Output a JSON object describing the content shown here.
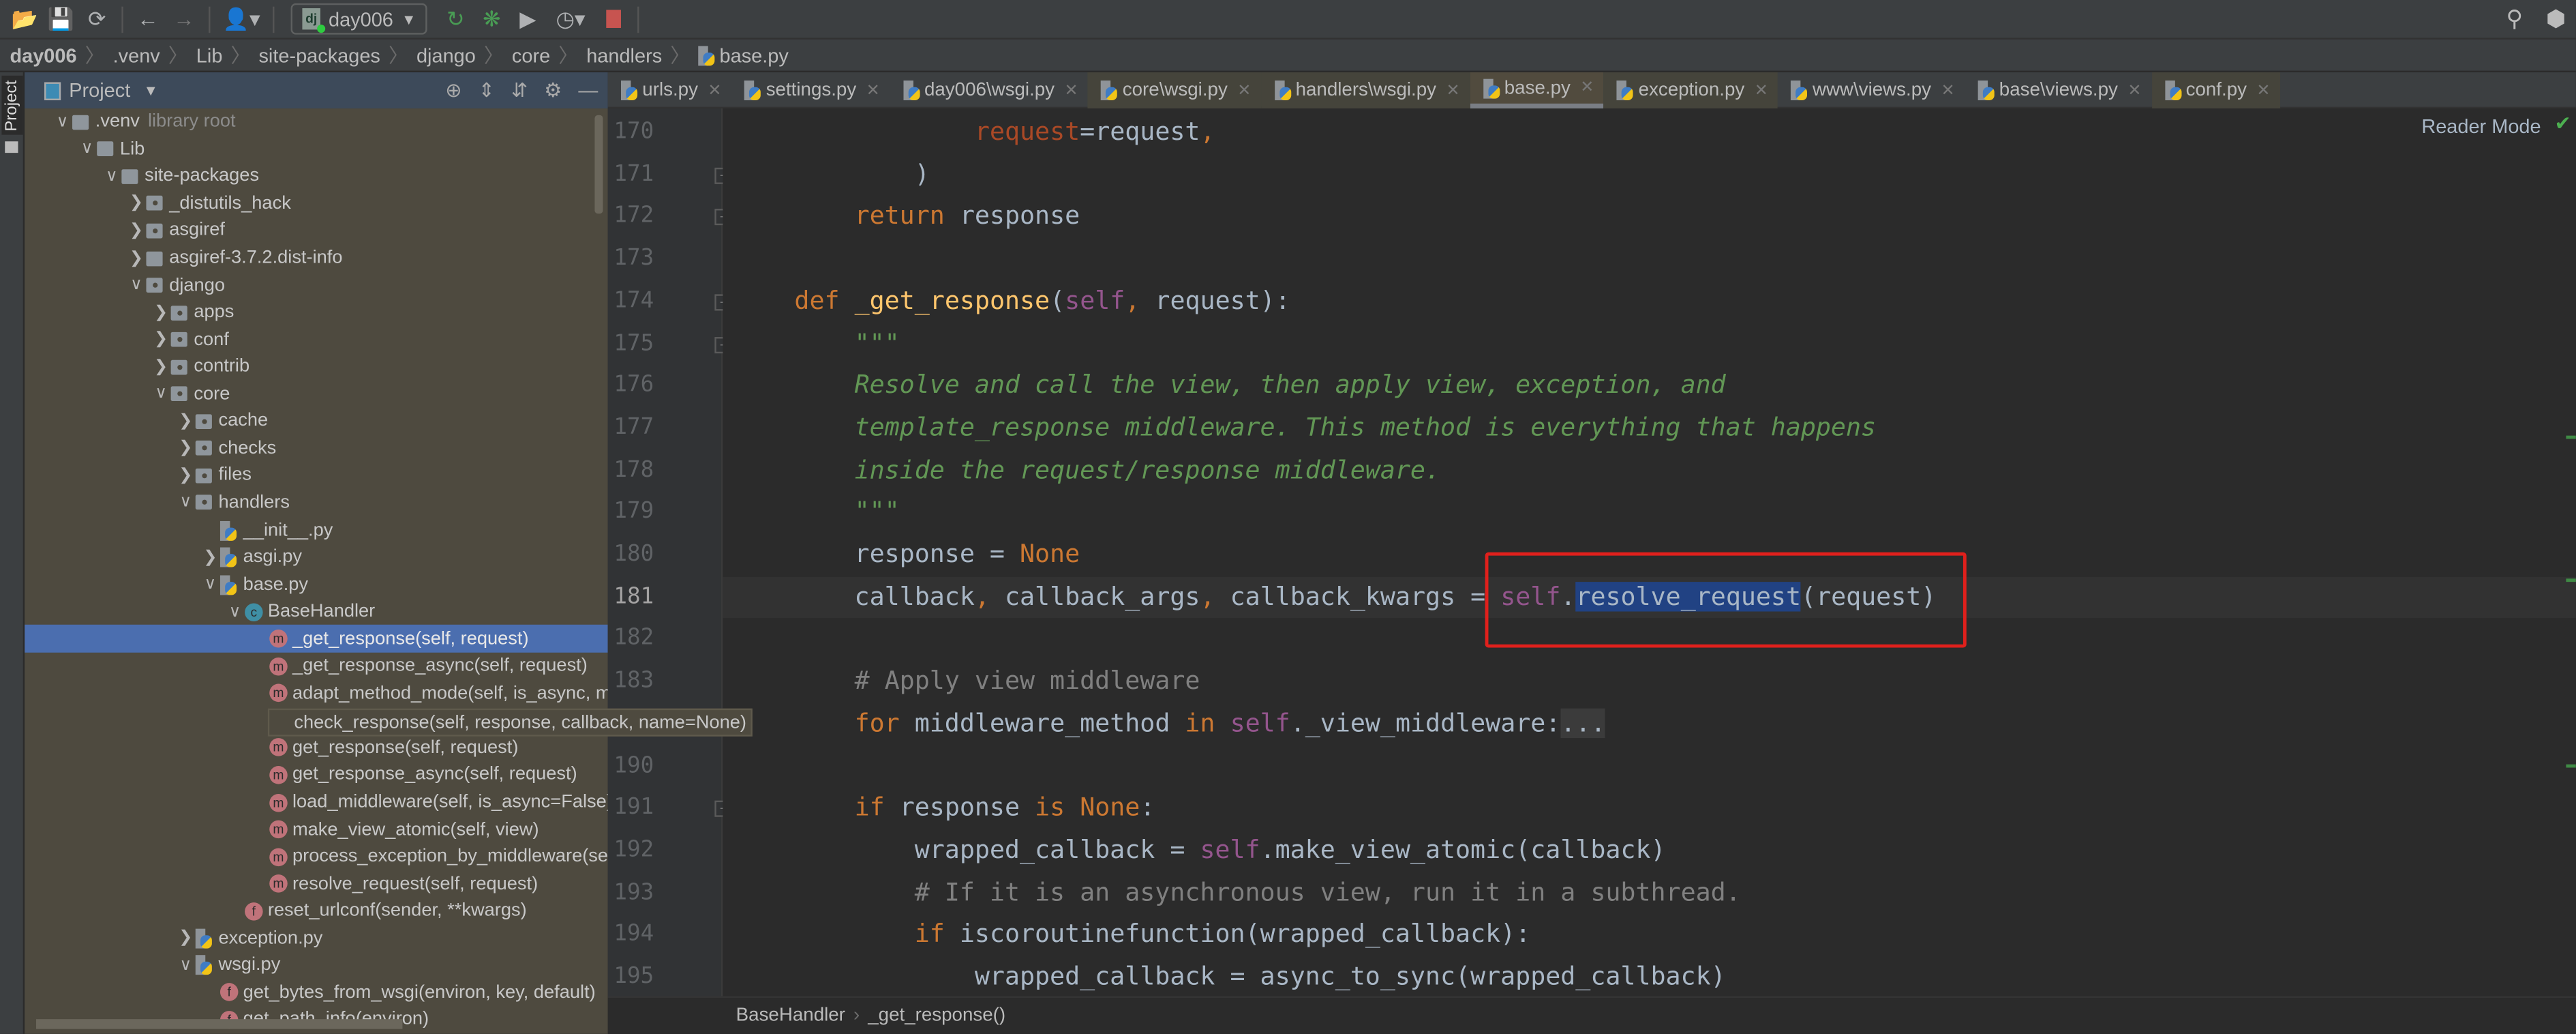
{
  "toolbar": {
    "icons": [
      "folder-open-icon",
      "save-icon",
      "sync-icon",
      "back-icon",
      "forward-icon",
      "user-icon"
    ],
    "run_config": "day006",
    "run_icons": [
      "rerun-icon",
      "debug-icon",
      "coverage-icon",
      "profile-icon",
      "stop-icon"
    ],
    "colors": {
      "run": "#499c54",
      "stop": "#c75450"
    }
  },
  "breadcrumb": [
    "day006",
    ".venv",
    "Lib",
    "site-packages",
    "django",
    "core",
    "handlers",
    "base.py"
  ],
  "side_stripe": {
    "label": "Project"
  },
  "project_panel": {
    "title": "Project"
  },
  "tree": [
    {
      "depth": 0,
      "arrow": "down",
      "icon": "folder",
      "label": ".venv",
      "suffix": "library root"
    },
    {
      "depth": 1,
      "arrow": "down",
      "icon": "folder",
      "label": "Lib"
    },
    {
      "depth": 2,
      "arrow": "down",
      "icon": "folder",
      "label": "site-packages"
    },
    {
      "depth": 3,
      "arrow": "right",
      "icon": "pkg",
      "label": "_distutils_hack"
    },
    {
      "depth": 3,
      "arrow": "right",
      "icon": "pkg",
      "label": "asgiref"
    },
    {
      "depth": 3,
      "arrow": "right",
      "icon": "folder",
      "label": "asgiref-3.7.2.dist-info"
    },
    {
      "depth": 3,
      "arrow": "down",
      "icon": "pkg",
      "label": "django"
    },
    {
      "depth": 4,
      "arrow": "right",
      "icon": "pkg",
      "label": "apps"
    },
    {
      "depth": 4,
      "arrow": "right",
      "icon": "pkg",
      "label": "conf"
    },
    {
      "depth": 4,
      "arrow": "right",
      "icon": "pkg",
      "label": "contrib"
    },
    {
      "depth": 4,
      "arrow": "down",
      "icon": "pkg",
      "label": "core"
    },
    {
      "depth": 5,
      "arrow": "right",
      "icon": "pkg",
      "label": "cache"
    },
    {
      "depth": 5,
      "arrow": "right",
      "icon": "pkg",
      "label": "checks"
    },
    {
      "depth": 5,
      "arrow": "right",
      "icon": "pkg",
      "label": "files"
    },
    {
      "depth": 5,
      "arrow": "down",
      "icon": "pkg",
      "label": "handlers"
    },
    {
      "depth": 6,
      "arrow": "none",
      "icon": "py",
      "label": "__init__.py"
    },
    {
      "depth": 6,
      "arrow": "right",
      "icon": "py",
      "label": "asgi.py"
    },
    {
      "depth": 6,
      "arrow": "down",
      "icon": "py",
      "label": "base.py"
    },
    {
      "depth": 7,
      "arrow": "down",
      "icon": "c",
      "label": "BaseHandler"
    },
    {
      "depth": 8,
      "arrow": "none",
      "icon": "m",
      "label": "_get_response(self, request)",
      "selected": true
    },
    {
      "depth": 8,
      "arrow": "none",
      "icon": "m",
      "label": "_get_response_async(self, request)"
    },
    {
      "depth": 8,
      "arrow": "none",
      "icon": "m",
      "label": "adapt_method_mode(self, is_async, meth"
    },
    {
      "depth": 8,
      "arrow": "none",
      "icon": "m",
      "label": "check_response(self, response, callback, name=None)"
    },
    {
      "depth": 8,
      "arrow": "none",
      "icon": "m",
      "label": "get_response(self, request)"
    },
    {
      "depth": 8,
      "arrow": "none",
      "icon": "m",
      "label": "get_response_async(self, request)"
    },
    {
      "depth": 8,
      "arrow": "none",
      "icon": "m",
      "label": "load_middleware(self, is_async=False)"
    },
    {
      "depth": 8,
      "arrow": "none",
      "icon": "m",
      "label": "make_view_atomic(self, view)"
    },
    {
      "depth": 8,
      "arrow": "none",
      "icon": "m",
      "label": "process_exception_by_middleware(self, e"
    },
    {
      "depth": 8,
      "arrow": "none",
      "icon": "m",
      "label": "resolve_request(self, request)"
    },
    {
      "depth": 7,
      "arrow": "none",
      "icon": "f",
      "label": "reset_urlconf(sender, **kwargs)"
    },
    {
      "depth": 5,
      "arrow": "right",
      "icon": "py",
      "label": "exception.py"
    },
    {
      "depth": 5,
      "arrow": "down",
      "icon": "py",
      "label": "wsgi.py"
    },
    {
      "depth": 6,
      "arrow": "none",
      "icon": "f",
      "label": "get_bytes_from_wsgi(environ, key, default)"
    },
    {
      "depth": 6,
      "arrow": "none",
      "icon": "f",
      "label": "get_path_info(environ)"
    }
  ],
  "tabs": [
    {
      "label": "urls.py",
      "style": "plain"
    },
    {
      "label": "settings.py",
      "style": "plain"
    },
    {
      "label": "day006\\wsgi.py",
      "style": "plain"
    },
    {
      "label": "core\\wsgi.py",
      "style": "olive"
    },
    {
      "label": "handlers\\wsgi.py",
      "style": "olive"
    },
    {
      "label": "base.py",
      "style": "active"
    },
    {
      "label": "exception.py",
      "style": "olive"
    },
    {
      "label": "www\\views.py",
      "style": "plain"
    },
    {
      "label": "base\\views.py",
      "style": "plain"
    },
    {
      "label": "conf.py",
      "style": "olive"
    }
  ],
  "editor": {
    "reader_mode": "Reader Mode",
    "current_line": "181",
    "lines": [
      {
        "n": "170",
        "t": [
          [
            "                "
          ],
          [
            "request",
            "param"
          ],
          [
            "=request"
          ],
          [
            ",",
            "kw"
          ]
        ]
      },
      {
        "n": "171",
        "t": [
          [
            "            )"
          ]
        ],
        "fold": true
      },
      {
        "n": "172",
        "t": [
          [
            "        "
          ],
          [
            "return",
            "kw"
          ],
          [
            " response"
          ]
        ],
        "fold": true
      },
      {
        "n": "173",
        "t": []
      },
      {
        "n": "174",
        "t": [
          [
            "    "
          ],
          [
            "def",
            "kw"
          ],
          [
            " "
          ],
          [
            "_get_response",
            "fn"
          ],
          [
            "("
          ],
          [
            "self",
            "self"
          ],
          [
            ",",
            "kw"
          ],
          [
            " request):"
          ]
        ],
        "fold": true
      },
      {
        "n": "175",
        "t": [
          [
            "        "
          ],
          [
            "\"\"\"",
            "doc"
          ]
        ],
        "fold": true
      },
      {
        "n": "176",
        "t": [
          [
            "        "
          ],
          [
            "Resolve and call the view, then apply view, exception, and",
            "doc"
          ]
        ]
      },
      {
        "n": "177",
        "t": [
          [
            "        "
          ],
          [
            "template_response middleware. This method is everything that happens",
            "doc"
          ]
        ]
      },
      {
        "n": "178",
        "t": [
          [
            "        "
          ],
          [
            "inside the request/response middleware.",
            "doc"
          ]
        ]
      },
      {
        "n": "179",
        "t": [
          [
            "        "
          ],
          [
            "\"\"\"",
            "doc"
          ]
        ]
      },
      {
        "n": "180",
        "t": [
          [
            "        response = "
          ],
          [
            "None",
            "kw"
          ]
        ]
      },
      {
        "n": "181",
        "t": [
          [
            "        callback"
          ],
          [
            ",",
            "kw"
          ],
          [
            " callback_args"
          ],
          [
            ",",
            "kw"
          ],
          [
            " callback_kwargs = "
          ],
          [
            "self",
            "self"
          ],
          [
            "."
          ],
          [
            "resolve_request",
            "hl"
          ],
          [
            "(request)"
          ]
        ]
      },
      {
        "n": "182",
        "t": []
      },
      {
        "n": "183",
        "t": [
          [
            "        "
          ],
          [
            "# Apply view middleware",
            "cmt"
          ]
        ]
      },
      {
        "n": "184",
        "t": [
          [
            "        "
          ],
          [
            "for",
            "kw"
          ],
          [
            " middleware_method "
          ],
          [
            "in",
            "kw"
          ],
          [
            " "
          ],
          [
            "self",
            "self"
          ],
          [
            "._view_middleware:"
          ],
          [
            "...",
            "fld"
          ]
        ],
        "fold": true
      },
      {
        "n": "190",
        "t": []
      },
      {
        "n": "191",
        "t": [
          [
            "        "
          ],
          [
            "if",
            "kw"
          ],
          [
            " response "
          ],
          [
            "is",
            "kw"
          ],
          [
            " "
          ],
          [
            "None",
            "kw"
          ],
          [
            ":"
          ]
        ],
        "fold": true
      },
      {
        "n": "192",
        "t": [
          [
            "            wrapped_callback = "
          ],
          [
            "self",
            "self"
          ],
          [
            ".make_view_atomic(callback)"
          ]
        ]
      },
      {
        "n": "193",
        "t": [
          [
            "            "
          ],
          [
            "# If it is an asynchronous view, run it in a subthread.",
            "cmt"
          ]
        ]
      },
      {
        "n": "194",
        "t": [
          [
            "            "
          ],
          [
            "if",
            "kw"
          ],
          [
            " iscoroutinefunction(wrapped_callback):"
          ]
        ]
      },
      {
        "n": "195",
        "t": [
          [
            "                wrapped_callback = async_to_sync(wrapped_callback)"
          ]
        ]
      }
    ]
  },
  "code_breadcrumb": [
    "BaseHandler",
    "_get_response()"
  ],
  "annotation": {
    "color": "#e0201c"
  }
}
